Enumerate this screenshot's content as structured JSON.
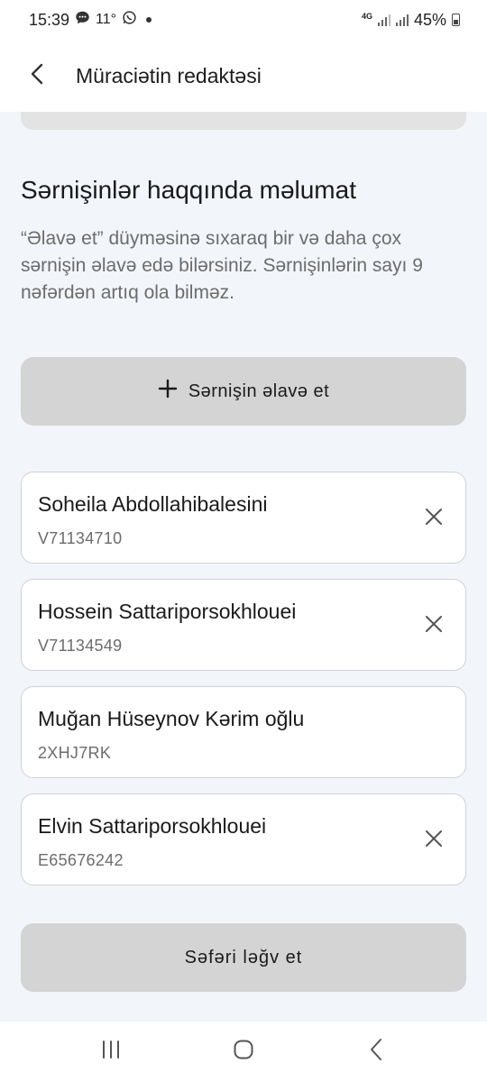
{
  "status_bar": {
    "time": "15:39",
    "temperature": "11°",
    "network": "4G",
    "battery": "45%",
    "icons": [
      "chat-bubble-icon",
      "whatsapp-icon",
      "dot-icon",
      "signal-icon",
      "signal-icon",
      "battery-icon"
    ]
  },
  "app_bar": {
    "title": "Müraciətin redaktəsi",
    "back_icon": "chevron-left-icon"
  },
  "section": {
    "title": "Sərnişinlər haqqında məlumat",
    "description": "“Əlavə et” düyməsinə sıxaraq bir və daha çox sərnişin əlavə edə bilərsiniz. Sərnişinlərin sayı 9 nəfərdən artıq ola bilməz."
  },
  "add_button": {
    "icon": "plus-icon",
    "label": "Sərnişin əlavə et"
  },
  "passengers": [
    {
      "name": "Soheila Abdollahibalesini",
      "document": "V71134710",
      "removable": true
    },
    {
      "name": "Hossein Sattariporsokhlouei",
      "document": "V71134549",
      "removable": true
    },
    {
      "name": "Muğan Hüseynov Kərim oğlu",
      "document": "2XHJ7RK",
      "removable": false
    },
    {
      "name": "Elvin Sattariporsokhlouei",
      "document": "E65676242",
      "removable": true
    }
  ],
  "cancel_button": {
    "label": "Səfəri ləğv et"
  },
  "nav_bar": {
    "icons": [
      "recent-apps-icon",
      "home-icon",
      "back-icon"
    ]
  },
  "colors": {
    "background": "#f2f5fa",
    "button_gray": "#d4d4d4",
    "card_border": "#cfd3d8",
    "muted_text": "#6c6c6c"
  }
}
